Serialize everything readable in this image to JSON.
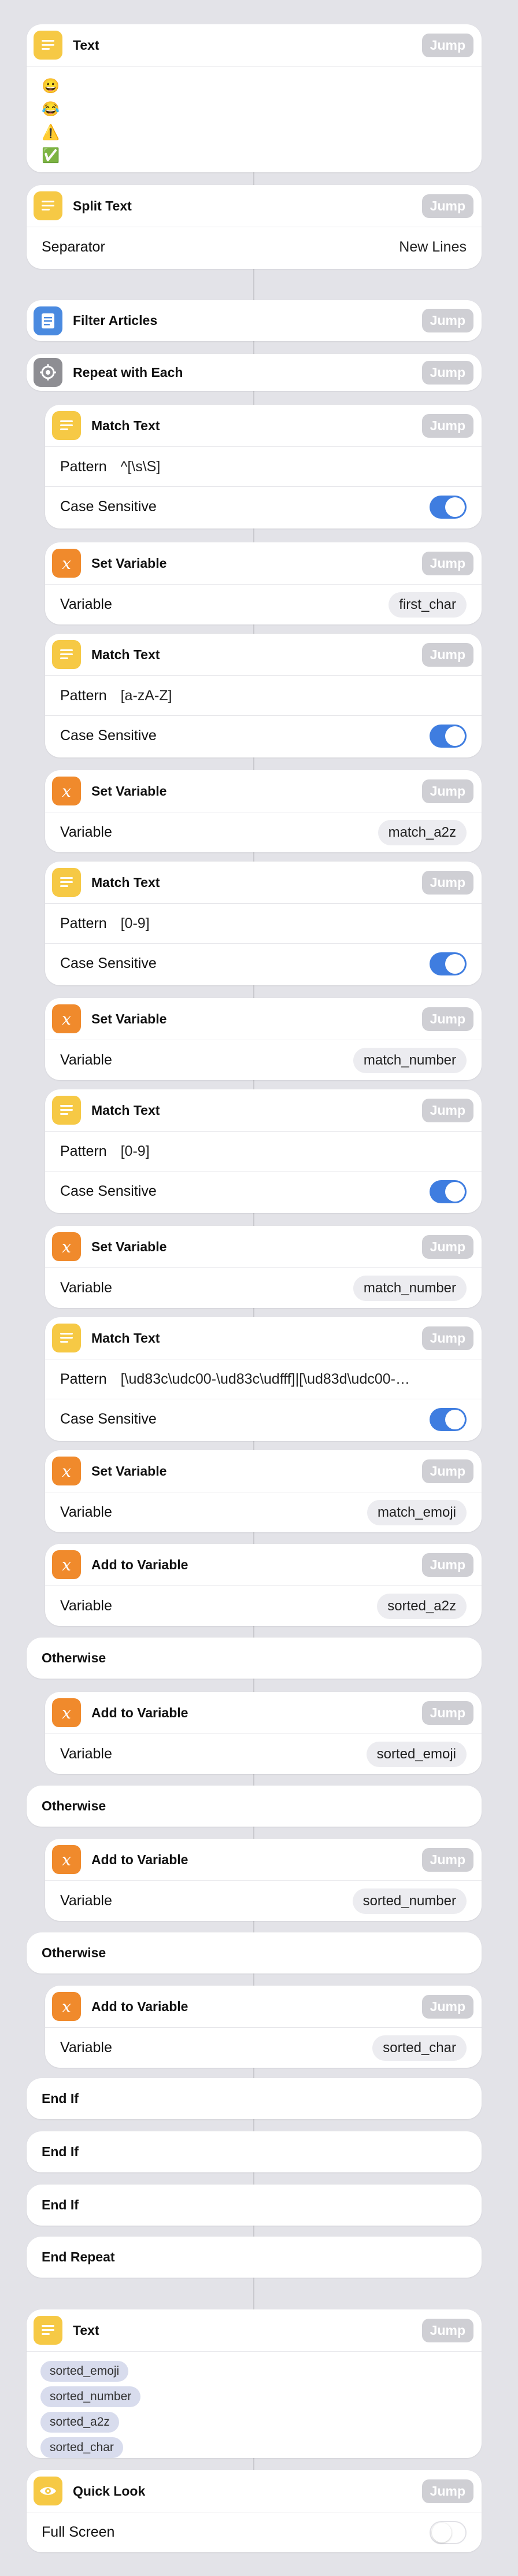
{
  "common": {
    "jump_label": "Jump"
  },
  "text_action": {
    "title": "Text",
    "emojis": [
      "😀",
      "😂",
      "⚠️",
      "✅",
      "👀👀"
    ]
  },
  "split_text": {
    "title": "Split Text",
    "separator_label": "Separator",
    "separator_value": "New Lines"
  },
  "filter_articles": {
    "title": "Filter Articles"
  },
  "repeat_each": {
    "title": "Repeat with Each"
  },
  "match_text_1": {
    "title": "Match Text",
    "pattern_label": "Pattern",
    "pattern_value": "^[\\s\\S]",
    "case_label": "Case Sensitive",
    "case_on": true
  },
  "set_var_1": {
    "title": "Set Variable",
    "var_label": "Variable",
    "var_value": "first_char"
  },
  "match_text_2": {
    "title": "Match Text",
    "pattern_label": "Pattern",
    "pattern_value": "[a-zA-Z]",
    "case_label": "Case Sensitive",
    "case_on": true
  },
  "set_var_2": {
    "title": "Set Variable",
    "var_label": "Variable",
    "var_value": "match_a2z"
  },
  "match_text_3": {
    "title": "Match Text",
    "pattern_label": "Pattern",
    "pattern_value": "[0-9]",
    "case_label": "Case Sensitive",
    "case_on": true
  },
  "set_var_3": {
    "title": "Set Variable",
    "var_label": "Variable",
    "var_value": "match_number"
  },
  "match_text_4": {
    "title": "Match Text",
    "pattern_label": "Pattern",
    "pattern_value": "[0-9]",
    "case_label": "Case Sensitive",
    "case_on": true
  },
  "set_var_4": {
    "title": "Set Variable",
    "var_label": "Variable",
    "var_value": "match_number"
  },
  "match_text_5": {
    "title": "Match Text",
    "pattern_label": "Pattern",
    "pattern_value": "[\\ud83c\\udc00-\\ud83c\\udfff]|[\\ud83d\\udc00-…",
    "case_label": "Case Sensitive",
    "case_on": true
  },
  "set_var_5": {
    "title": "Set Variable",
    "var_label": "Variable",
    "var_value": "match_emoji"
  },
  "add_var_1": {
    "title": "Add to Variable",
    "var_label": "Variable",
    "var_value": "sorted_a2z"
  },
  "otherwise_1": {
    "title": "Otherwise"
  },
  "add_var_2": {
    "title": "Add to Variable",
    "var_label": "Variable",
    "var_value": "sorted_emoji"
  },
  "otherwise_2": {
    "title": "Otherwise"
  },
  "add_var_3": {
    "title": "Add to Variable",
    "var_label": "Variable",
    "var_value": "sorted_number"
  },
  "otherwise_3": {
    "title": "Otherwise"
  },
  "add_var_4": {
    "title": "Add to Variable",
    "var_label": "Variable",
    "var_value": "sorted_char"
  },
  "end_if_1": {
    "title": "End If"
  },
  "end_if_2": {
    "title": "End If"
  },
  "end_if_3": {
    "title": "End If"
  },
  "end_repeat": {
    "title": "End Repeat"
  },
  "text_final": {
    "title": "Text",
    "vars": [
      "sorted_emoji",
      "sorted_number",
      "sorted_a2z",
      "sorted_char"
    ]
  },
  "quick_look": {
    "title": "Quick Look",
    "fullscreen_label": "Full Screen",
    "fullscreen_on": false
  },
  "colors": {
    "background": "#e3e3e8",
    "yellow_icon": "#f6c945",
    "orange_icon": "#f08a2c",
    "blue_icon": "#4a8ae0",
    "toggle_on": "#3f7de0",
    "jump_bg": "#cfcfd4"
  }
}
